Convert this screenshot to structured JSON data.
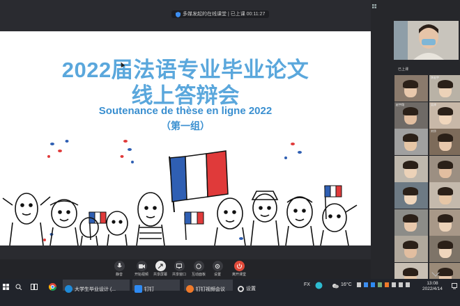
{
  "meeting": {
    "status_text": "多媒发起的在线课堂 | 已上课 00:11:27"
  },
  "slide": {
    "title_line1": "2022届法语专业毕业论文",
    "title_line2": "线上答辩会",
    "subtitle": "Soutenance de thèse en ligne 2022",
    "group": "（第一组）"
  },
  "toolbar": {
    "items": [
      {
        "label": "静音",
        "icon": "mute-icon"
      },
      {
        "label": "开始视频",
        "icon": "video-icon"
      },
      {
        "label": "共享屏幕",
        "icon": "share-screen-icon"
      },
      {
        "label": "共享窗口",
        "icon": "window-icon"
      },
      {
        "label": "互动面板",
        "icon": "chat-icon"
      },
      {
        "label": "设置",
        "icon": "settings-icon"
      },
      {
        "label": "离开课堂",
        "icon": "leave-icon"
      }
    ]
  },
  "panel": {
    "section_label": "已上课",
    "participants": [
      "",
      "李宏宇",
      "赵宇翔",
      "吴泽",
      "",
      "刘华",
      "",
      "",
      "",
      "",
      "",
      "",
      "",
      "",
      "",
      "",
      "",
      ""
    ]
  },
  "taskbar": {
    "items": [
      {
        "label": "大学生毕业设计 (...",
        "icon": "edge-icon"
      },
      {
        "label": "钉钉",
        "icon": "dingtalk-icon"
      },
      {
        "label": "钉钉视频会议",
        "icon": "dingtalk-meeting-icon"
      },
      {
        "label": "设置",
        "icon": "gear-icon"
      }
    ],
    "language": "FX",
    "weather": "16°C",
    "time": "13:08",
    "date": "2022/4/14"
  },
  "colors": {
    "title_blue": "#5aa7dc",
    "flag_blue": "#2f5fb3",
    "flag_red": "#e03a3a"
  }
}
